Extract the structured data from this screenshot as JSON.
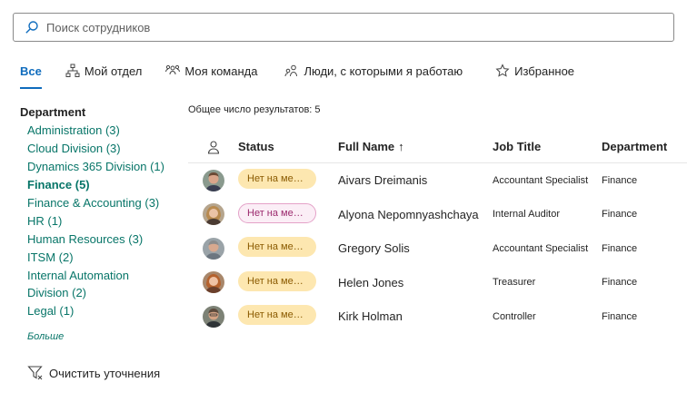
{
  "search": {
    "placeholder": "Поиск сотрудников"
  },
  "tabs": [
    {
      "label": "Все",
      "icon": "none",
      "active": true
    },
    {
      "label": "Мой отдел",
      "icon": "org-chart-icon"
    },
    {
      "label": "Моя команда",
      "icon": "team-icon"
    },
    {
      "label": "Люди, с которыми я работаю",
      "icon": "people-icon"
    },
    {
      "label": "Избранное",
      "icon": "star-icon"
    }
  ],
  "refiner": {
    "title": "Department",
    "items": [
      "Administration (3)",
      "Cloud Division (3)",
      "Dynamics 365 Division (1)",
      "Finance (5)",
      "Finance & Accounting (3)",
      "HR (1)",
      "Human Resources (3)",
      "ITSM (2)",
      "Internal Automation",
      "Division (2)",
      "Legal (1)"
    ],
    "more_label": "Больше",
    "clear_label": "Очистить уточнения"
  },
  "results": {
    "total_label": "Общее число результатов: 5"
  },
  "table": {
    "headers": {
      "status": "Status",
      "name": "Full Name",
      "sort_arrow": "↑",
      "job": "Job Title",
      "dept": "Department"
    },
    "rows": [
      {
        "status": "Нет на месте",
        "name": "Aivars Dreimanis",
        "job": "Accountant Specialist",
        "dept": "Finance"
      },
      {
        "status": "Нет на месте",
        "name": "Alyona Nepomnyashchaya",
        "job": "Internal Auditor",
        "dept": "Finance"
      },
      {
        "status": "Нет на месте",
        "name": "Gregory Solis",
        "job": "Accountant Specialist",
        "dept": "Finance"
      },
      {
        "status": "Нет на месте",
        "name": "Helen Jones",
        "job": "Treasurer",
        "dept": "Finance"
      },
      {
        "status": "Нет на месте",
        "name": "Kirk Holman",
        "job": "Controller",
        "dept": "Finance"
      }
    ]
  },
  "colors": {
    "accent": "#0f6cbd",
    "link": "#077568",
    "badge_away_bg": "#fde7b0",
    "badge_away_text": "#8a5a00",
    "badge_pink_bg": "#fbeef6",
    "badge_pink_border": "#e4a2c8",
    "badge_pink_text": "#9c2a6e"
  }
}
